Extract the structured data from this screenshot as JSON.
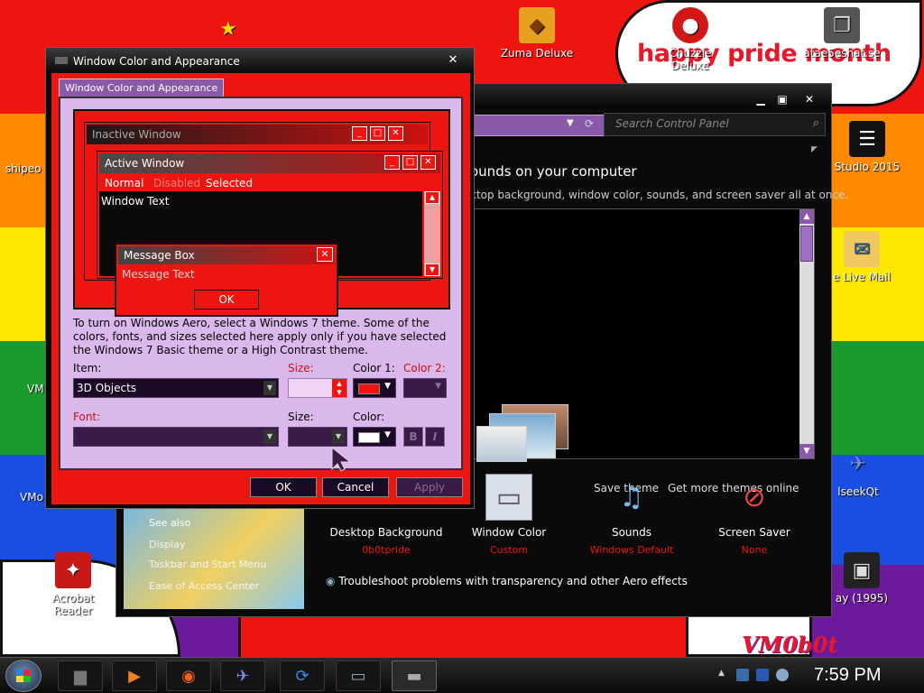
{
  "desktop": {
    "banner_text": "happy pride month",
    "signature_text": "VM0b0t",
    "icons": {
      "zuma": "Zuma Deluxe",
      "chuzzle": "Chuzzle Deluxe",
      "ataeseshat": "atae5eshat.se",
      "shipeo": "shipeo",
      "studio": "Studio 2015",
      "livemail": "e Live Mail",
      "vm_left": "VM",
      "vm_left2": "VMo",
      "qeek": "lseekQt",
      "acrobat": "Acrobat Reader",
      "jay": "ay (1995)"
    }
  },
  "cp": {
    "search_placeholder": "Search Control Panel",
    "heading": "ounds on your computer",
    "subheading": "ktop background, window color, sounds, and screen saver all at once.",
    "save_theme": "Save theme",
    "get_more": "Get more themes online",
    "see_also": "See also",
    "see_also_items": [
      "Display",
      "Taskbar and Start Menu",
      "Ease of Access Center"
    ],
    "bottom": [
      {
        "label": "Desktop Background",
        "sub": "0b0tpride"
      },
      {
        "label": "Window Color",
        "sub": "Custom"
      },
      {
        "label": "Sounds",
        "sub": "Windows Default"
      },
      {
        "label": "Screen Saver",
        "sub": "None"
      }
    ],
    "troubleshoot": "Troubleshoot problems with transparency and other Aero effects"
  },
  "dialog": {
    "title": "Window Color and Appearance",
    "tab": "Window Color and Appearance",
    "close_glyph": "✕",
    "preview": {
      "inactive_title": "Inactive Window",
      "active_title": "Active Window",
      "menu_normal": "Normal",
      "menu_disabled": "Disabled",
      "menu_selected": "Selected",
      "window_text": "Window Text",
      "msg_title": "Message Box",
      "msg_text": "Message Text",
      "msg_ok": "OK"
    },
    "info": "To turn on Windows Aero, select a Windows 7 theme.  Some of the colors, fonts, and sizes selected here apply only if you have selected the Windows 7 Basic theme or a High Contrast theme.",
    "item_label": "Item:",
    "item_value": "3D Objects",
    "size_label": "Size:",
    "color1_label": "Color 1:",
    "color2_label": "Color 2:",
    "font_label": "Font:",
    "fsize_label": "Size:",
    "fcolor_label": "Color:",
    "bold_glyph": "B",
    "italic_glyph": "I",
    "ok": "OK",
    "cancel": "Cancel",
    "apply": "Apply",
    "colors": {
      "color1": "#ee1410",
      "font_color": "#ffffff"
    }
  },
  "taskbar": {
    "clock": "7:59 PM"
  }
}
